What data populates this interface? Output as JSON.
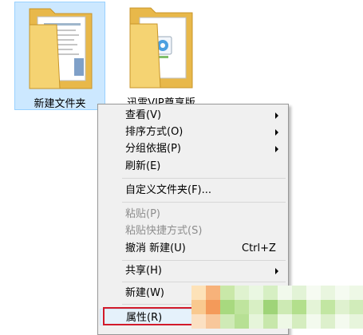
{
  "desktop": {
    "folders": [
      {
        "name": "新建文件夹",
        "selected": true
      },
      {
        "name": "迅雷VIP尊享版",
        "selected": false
      }
    ]
  },
  "context_menu": {
    "items": [
      {
        "label": "查看(V)",
        "submenu": true
      },
      {
        "label": "排序方式(O)",
        "submenu": true
      },
      {
        "label": "分组依据(P)",
        "submenu": true
      },
      {
        "label": "刷新(E)"
      },
      {
        "label": "自定义文件夹(F)..."
      },
      {
        "label": "粘贴(P)",
        "disabled": true
      },
      {
        "label": "粘贴快捷方式(S)",
        "disabled": true
      },
      {
        "label": "撤消 新建(U)",
        "shortcut": "Ctrl+Z"
      },
      {
        "label": "共享(H)",
        "submenu": true
      },
      {
        "label": "新建(W)",
        "submenu": true
      },
      {
        "label": "属性(R)",
        "highlighted": true
      }
    ]
  },
  "colors": {
    "selection_fill": "#cce8ff",
    "selection_border": "#99d1ff",
    "menu_background": "#f0f0f0",
    "highlight_outline": "#d21a2a",
    "folder_yellow": "#f5d372"
  }
}
